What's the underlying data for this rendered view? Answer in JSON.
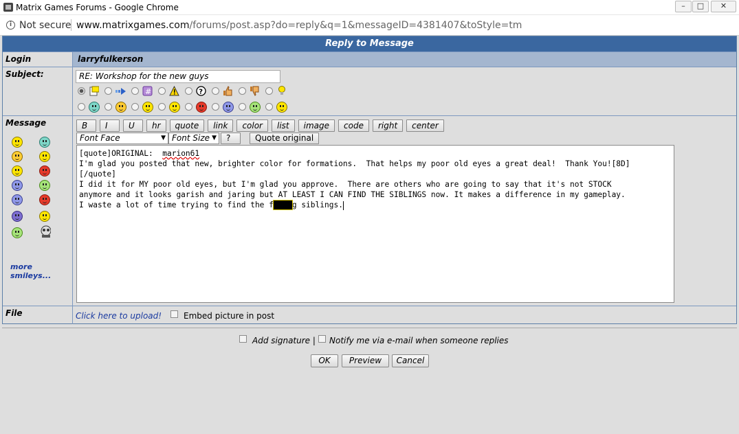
{
  "window": {
    "title": "Matrix Games Forums - Google Chrome",
    "minimize_label": "–",
    "maximize_label": "□",
    "close_label": "✕"
  },
  "address_bar": {
    "security_label": "Not secure",
    "url_host": "www.matrixgames.com",
    "url_path": "/forums/post.asp?do=reply&q=1&messageID=4381407&toStyle=tm"
  },
  "form": {
    "header": "Reply to Message",
    "login_label": "Login",
    "login_value": "larryfulkerson",
    "subject_label": "Subject:",
    "subject_value": "RE: Workshop for the new guys",
    "post_icons_row1": [
      "document-icon",
      "arrow-right-icon",
      "hash-icon",
      "warning-icon",
      "question-icon",
      "thumbs-up-icon",
      "thumbs-down-icon",
      "lightbulb-icon"
    ],
    "post_icons_row2": [
      "grin-icon",
      "cool-icon",
      "smile-icon",
      "confused-icon",
      "angry-icon",
      "sad-icon",
      "green-smile-icon",
      "smile2-icon"
    ],
    "message_label": "Message",
    "format_buttons": [
      "B",
      "I",
      "U",
      "hr",
      "quote",
      "link",
      "color",
      "list",
      "image",
      "code",
      "right",
      "center"
    ],
    "font_face_label": "Font Face",
    "font_size_label": "Font Size",
    "help_label": "?",
    "quote_original_label": "Quote original",
    "message_lines": {
      "l1_a": "[quote]ORIGINAL:  ",
      "l1_b": "marion61",
      "l2": "I'm glad you posted that new, brighter color for formations.  That helps my poor old eyes a great deal!  Thank You![8D]",
      "l3": "[/quote]",
      "l4": "I did it for MY poor old eyes, but I'm glad you approve.  There are others who are going to say that it's not STOCK",
      "l5": "anymore and it looks garish and jaring but AT LEAST I CAN FIND THE SIBLINGS now. It makes a difference in my gameplay.",
      "l6_a": "I waste a lot of time trying to find the f",
      "l6_redacted": "■■■■",
      "l6_b": "g siblings."
    },
    "more_smileys_label": "more smileys...",
    "file_label": "File",
    "upload_label": "Click here to upload!",
    "embed_label": "Embed picture in post"
  },
  "options": {
    "add_signature_label": "Add signature |",
    "notify_label": "Notify me via e-mail when someone replies"
  },
  "actions": {
    "ok_label": "OK",
    "preview_label": "Preview",
    "cancel_label": "Cancel"
  }
}
